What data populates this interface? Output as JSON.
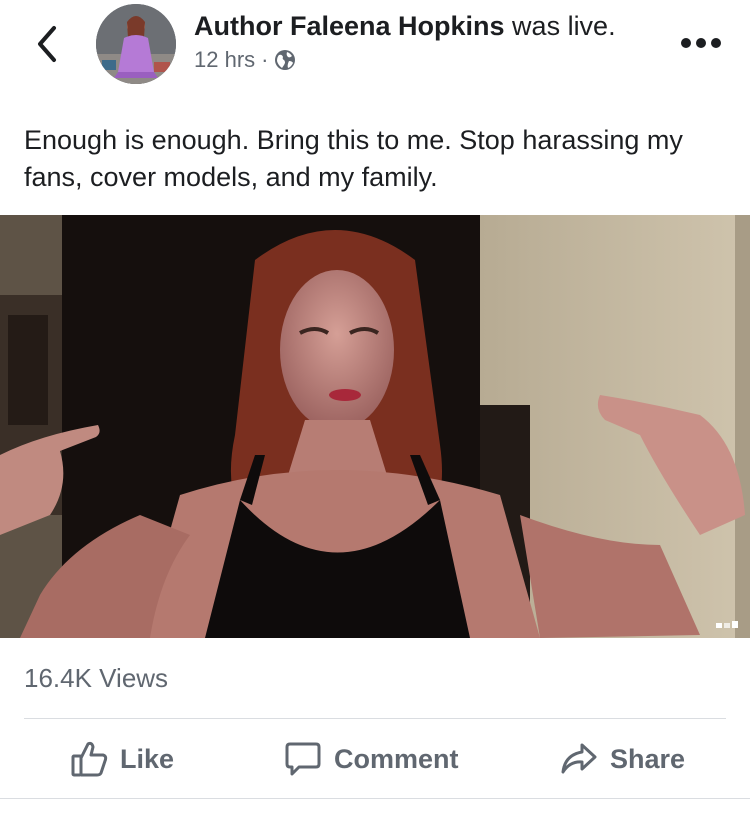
{
  "post": {
    "author": "Author Faleena Hopkins",
    "action": " was live.",
    "time": "12 hrs",
    "separator": "·",
    "text": "Enough is enough. Bring this to me. Stop harassing my fans, cover models, and my family."
  },
  "icons": {
    "back": "chevron-left-icon",
    "more": "more-dots-icon",
    "privacy": "globe-icon",
    "like": "thumbs-up-icon",
    "comment": "comment-bubble-icon",
    "share": "share-arrow-icon"
  },
  "stats": {
    "views": "16.4K Views"
  },
  "actions": {
    "like": "Like",
    "comment": "Comment",
    "share": "Share"
  },
  "colors": {
    "text": "#1c1e21",
    "secondary": "#606770",
    "divider": "#dadde1"
  }
}
